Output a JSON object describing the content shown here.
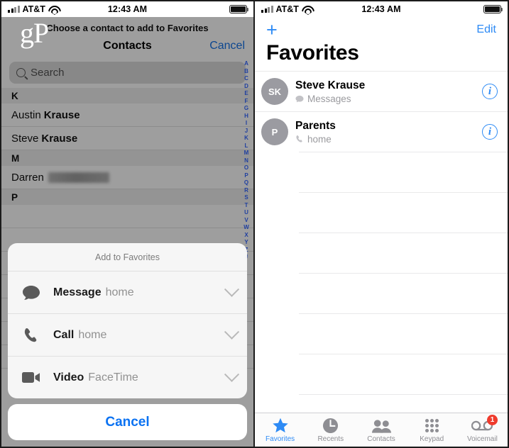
{
  "status_bar": {
    "carrier": "AT&T",
    "time": "12:43 AM",
    "signal_icon": "signal-bars-icon",
    "wifi_icon": "wifi-icon",
    "battery_icon": "battery-icon"
  },
  "watermark": {
    "text": "gP"
  },
  "left_screen": {
    "prompt": "Choose a contact to add to Favorites",
    "nav": {
      "title": "Contacts",
      "cancel_label": "Cancel"
    },
    "search": {
      "placeholder": "Search",
      "icon": "search-icon"
    },
    "sections": [
      {
        "letter": "K",
        "contacts": [
          {
            "first": "Austin",
            "last": "Krause",
            "redacted": false
          },
          {
            "first": "Steve",
            "last": "Krause",
            "redacted": false
          }
        ]
      },
      {
        "letter": "M",
        "contacts": [
          {
            "first": "Darren",
            "last": "",
            "redacted": true
          }
        ]
      },
      {
        "letter": "P",
        "contacts": []
      }
    ],
    "alpha_index": [
      "A",
      "B",
      "C",
      "D",
      "E",
      "F",
      "G",
      "H",
      "I",
      "J",
      "K",
      "L",
      "M",
      "N",
      "O",
      "P",
      "Q",
      "R",
      "S",
      "T",
      "U",
      "V",
      "W",
      "X",
      "Y",
      "Z",
      "#"
    ],
    "action_sheet": {
      "title": "Add to Favorites",
      "items": [
        {
          "icon": "message-bubble-icon",
          "action": "Message",
          "detail": "home",
          "chevron": "chevron-down-icon"
        },
        {
          "icon": "phone-handset-icon",
          "action": "Call",
          "detail": "home",
          "chevron": "chevron-down-icon"
        },
        {
          "icon": "video-camera-icon",
          "action": "Video",
          "detail": "FaceTime",
          "chevron": "chevron-down-icon"
        }
      ],
      "cancel_label": "Cancel"
    }
  },
  "right_screen": {
    "add_label": "+",
    "edit_label": "Edit",
    "title": "Favorites",
    "favorites": [
      {
        "initials": "SK",
        "name": "Steve Krause",
        "sub": "Messages",
        "sub_icon": "message-bubble-icon",
        "info_icon": "info-icon"
      },
      {
        "initials": "P",
        "name": "Parents",
        "sub": "home",
        "sub_icon": "phone-handset-icon",
        "info_icon": "info-icon"
      }
    ],
    "empty_row_count": 7,
    "tabs": [
      {
        "label": "Favorites",
        "icon": "star-icon",
        "active": true,
        "badge": ""
      },
      {
        "label": "Recents",
        "icon": "clock-icon",
        "active": false,
        "badge": ""
      },
      {
        "label": "Contacts",
        "icon": "people-icon",
        "active": false,
        "badge": ""
      },
      {
        "label": "Keypad",
        "icon": "keypad-dots-icon",
        "active": false,
        "badge": ""
      },
      {
        "label": "Voicemail",
        "icon": "voicemail-icon",
        "active": false,
        "badge": "1"
      }
    ]
  },
  "colors": {
    "accent_blue": "#2e8bf5",
    "link_blue": "#1673e8",
    "badge_red": "#ef3b2d",
    "tab_inactive": "#8e8e93",
    "index_blue": "#1f3fa0"
  }
}
